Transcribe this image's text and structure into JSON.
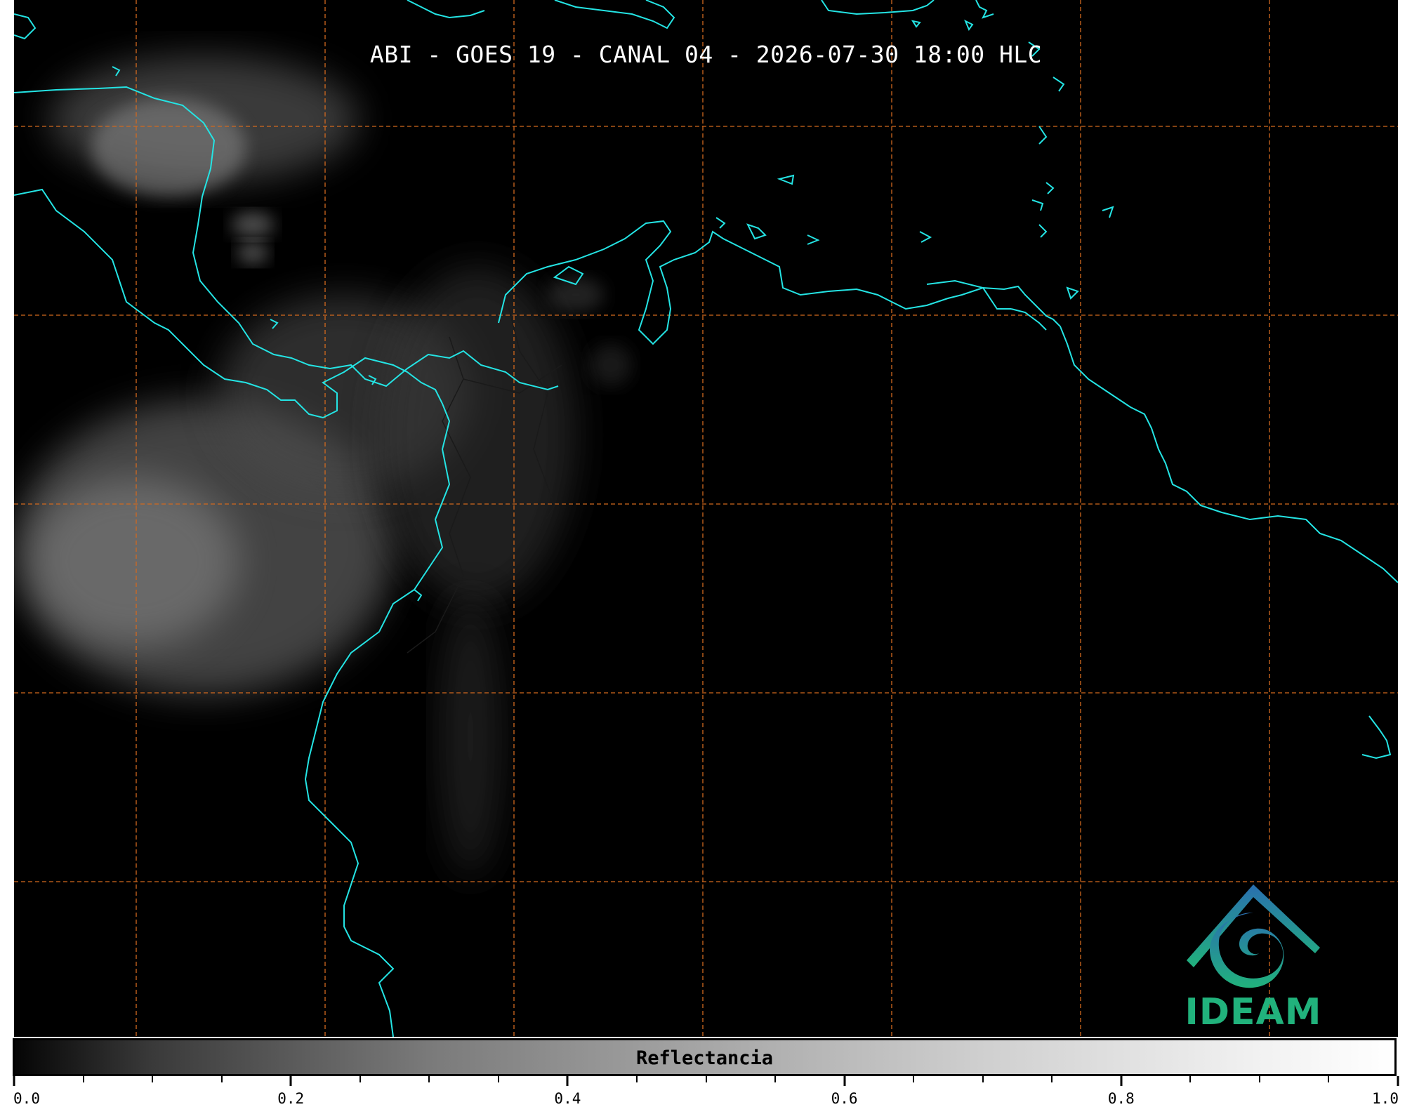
{
  "title": "ABI - GOES 19 - CANAL 04 - 2026-07-30 18:00 HLC",
  "colorbar": {
    "label": "Reflectancia",
    "min": 0.0,
    "max": 1.0,
    "ticks": [
      "0.0",
      "0.2",
      "0.4",
      "0.6",
      "0.8",
      "1.0"
    ],
    "minor_ticks_per_interval": 4
  },
  "logo": {
    "text": "IDEAM"
  },
  "colors": {
    "coastline": "#24e4e4",
    "gridline": "#d2691e",
    "background": "#000000",
    "logo_blue": "#2a6fb0",
    "logo_green": "#21b27c"
  }
}
